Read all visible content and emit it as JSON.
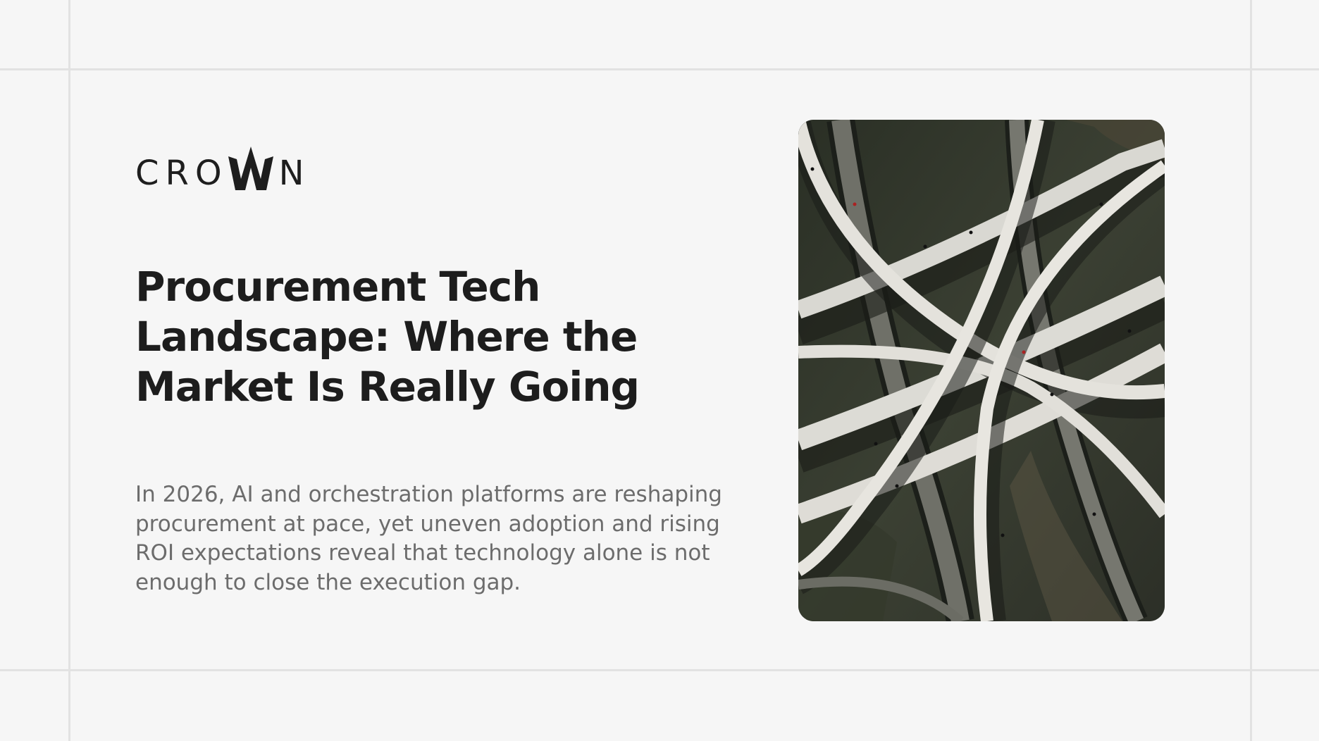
{
  "brand": {
    "logo_left_text": "CRO",
    "logo_right_text": "N"
  },
  "article": {
    "headline": "Procurement Tech Landscape: Where the Market Is Really Going",
    "summary": "In 2026, AI and orchestration platforms are reshaping procurement at pace, yet uneven adoption and rising ROI expectations reveal that technology alone is not enough to close the execution gap."
  },
  "colors": {
    "background": "#f6f6f6",
    "guide_lines": "#e2e2e2",
    "headline": "#1d1d1d",
    "summary": "#6c6c6c"
  }
}
